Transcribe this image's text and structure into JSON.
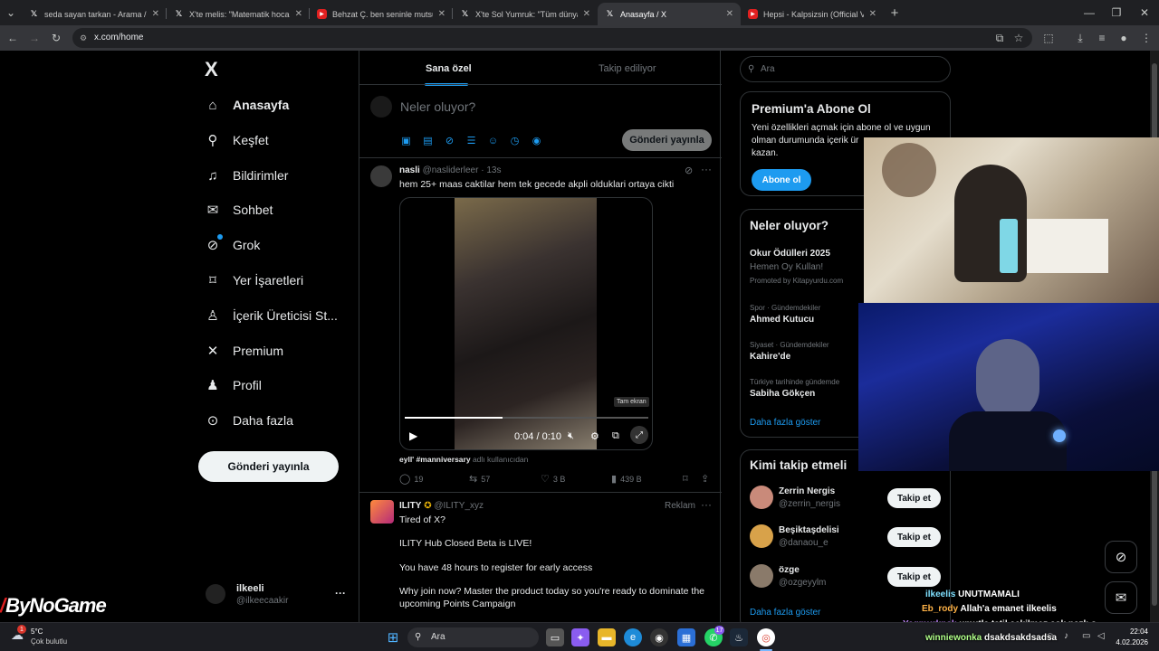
{
  "browser": {
    "tabs": [
      {
        "title": "seda sayan tarkan - Arama / X",
        "favicon": "x"
      },
      {
        "title": "X'te melis: \"Matematik hocası b",
        "favicon": "x"
      },
      {
        "title": "Behzat Ç. ben seninle mutsuzlu",
        "favicon": "youtube"
      },
      {
        "title": "X'te Sol Yumruk: \"Tüm dünya s",
        "favicon": "x"
      },
      {
        "title": "Anasayfa / X",
        "favicon": "x",
        "active": true
      },
      {
        "title": "Hepsi - Kalpsizsin (Official Vide",
        "favicon": "youtube"
      }
    ],
    "new_tab": "+",
    "url": "x.com/home"
  },
  "nav": {
    "logo": "X",
    "items": [
      {
        "label": "Anasayfa",
        "icon": "home-icon"
      },
      {
        "label": "Keşfet",
        "icon": "search-icon"
      },
      {
        "label": "Bildirimler",
        "icon": "bell-icon"
      },
      {
        "label": "Sohbet",
        "icon": "mail-icon"
      },
      {
        "label": "Grok",
        "icon": "grok-icon"
      },
      {
        "label": "Yer İşaretleri",
        "icon": "bookmark-icon"
      },
      {
        "label": "İçerik Üreticisi St...",
        "icon": "creator-icon"
      },
      {
        "label": "Premium",
        "icon": "x-icon"
      },
      {
        "label": "Profil",
        "icon": "person-icon"
      },
      {
        "label": "Daha fazla",
        "icon": "more-circle-icon"
      }
    ],
    "post_button": "Gönderi yayınla",
    "account": {
      "name": "ilkeeli",
      "handle": "@ilkeecaakir",
      "more": "···"
    }
  },
  "feed": {
    "tabs": [
      "Sana özel",
      "Takip ediliyor"
    ],
    "composer": {
      "placeholder": "Neler oluyor?",
      "button": "Gönderi yayınla"
    },
    "post1": {
      "name": "nasli",
      "handle": "@nasliderleer",
      "time": "· 13s",
      "text": "hem 25+ maas caktilar hem tek gecede akpli olduklari ortaya cikti",
      "video_time": "0:04 / 0:10",
      "progress": 0.4,
      "tooltip": "Tam ekran",
      "attribution_user": "eyll' #manniversary",
      "attribution_suffix": "adlı kullanıcıdan",
      "replies": "19",
      "reposts": "57",
      "likes": "3 B",
      "views": "439 B"
    },
    "post2": {
      "name": "ILITY",
      "handle": "@ILITY_xyz",
      "badge": "Reklam",
      "lines": [
        "Tired of X?",
        "ILITY Hub Closed Beta is LIVE!",
        "You have 48 hours to register for early access",
        "Why join now? Master the product today so you're ready to dominate the",
        "upcoming Points Campaign"
      ]
    }
  },
  "sidebar": {
    "search_placeholder": "Ara",
    "premium": {
      "title": "Premium'a Abone Ol",
      "line1": "Yeni özellikleri açmak için abone ol ve uygun",
      "line2": "olman durumunda içerik ür",
      "line3": "kazan.",
      "button": "Abone ol"
    },
    "trends": {
      "title": "Neler oluyor?",
      "promo_title": "Okur Ödülleri 2025",
      "promo_sub": "Hemen Oy Kullan!",
      "promo_by": "Promoted by Kitapyurdu.com",
      "items": [
        {
          "category": "Spor · Gündemdekiler",
          "name": "Ahmed Kutucu"
        },
        {
          "category": "Siyaset · Gündemdekiler",
          "name": "Kahire'de"
        },
        {
          "category": "Türkiye tarihinde gündemde",
          "name": "Sabiha Gökçen"
        }
      ],
      "more": "Daha fazla göster"
    },
    "who_to_follow": {
      "title": "Kimi takip etmeli",
      "users": [
        {
          "name": "Zerrin Nergis",
          "handle": "@zerrin_nergis",
          "button": "Takip et"
        },
        {
          "name": "Beşiktaşdelisi",
          "handle": "@danaou_e",
          "button": "Takip et"
        },
        {
          "name": "özge",
          "handle": "@ozgeyylm",
          "button": "Takip et"
        }
      ],
      "more": "Daha fazla göster"
    }
  },
  "overlay": {
    "brand": "ByNoGame",
    "chat": [
      {
        "user": "ilkeelis",
        "msg": "UNUTMAMALI",
        "color": "#7fe0ff"
      },
      {
        "user": "Eb_rody",
        "msg": "Allah'a emanet ilkeelis",
        "color": "#ffb347"
      },
      {
        "user": "Yagmurknsk",
        "msg": "umutla tatil çekilmez çok nazlı o",
        "color": "#c58bff"
      },
      {
        "user": "winniewonka",
        "msg": "dsakdsakdsadsa",
        "color": "#b0ff8a"
      }
    ]
  },
  "taskbar": {
    "weather_temp": "5°C",
    "weather_desc": "Çok bulutlu",
    "search": "Ara",
    "time": "22:04",
    "date": "4.02.2026",
    "badge_count": "17",
    "weather_badge": "1"
  }
}
